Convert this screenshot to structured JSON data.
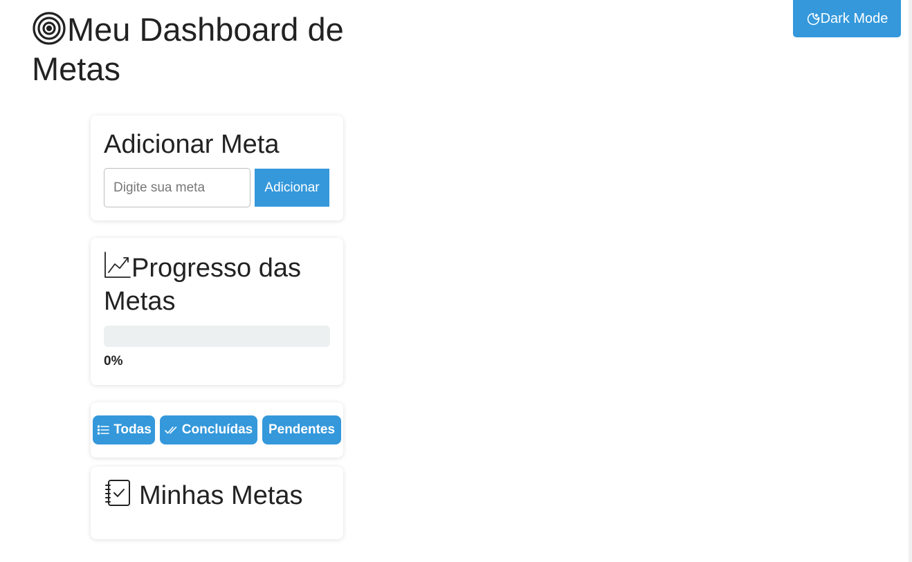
{
  "header": {
    "title": "Meu Dashboard de Metas",
    "title_icon": "target-icon",
    "dark_mode_label": "Dark Mode",
    "dark_mode_icon": "moon-stars-icon"
  },
  "add_goal": {
    "title": "Adicionar Meta",
    "input_placeholder": "Digite sua meta",
    "input_value": "",
    "button_label": "Adicionar"
  },
  "progress": {
    "title": "Progresso das Metas",
    "icon": "trend-chart-icon",
    "percent_label": "0%",
    "fraction_complete": 0
  },
  "filters": {
    "buttons": [
      {
        "label": "Todas",
        "icon": "list-icon"
      },
      {
        "label": "Concluídas",
        "icon": "double-check-icon"
      },
      {
        "label": "Pendentes",
        "icon": ""
      }
    ]
  },
  "goals": {
    "title": "Minhas Metas",
    "icon": "checklist-notebook-icon",
    "items": []
  },
  "colors": {
    "accent": "#3498db",
    "progress_track": "#ecf0f1",
    "text": "#222222"
  }
}
